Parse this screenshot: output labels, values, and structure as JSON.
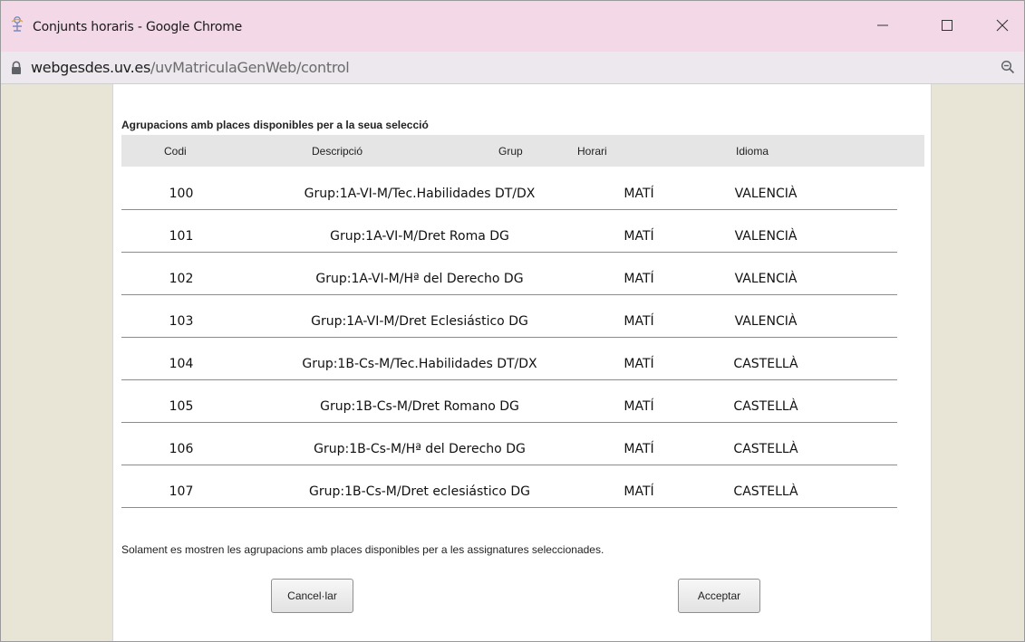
{
  "window": {
    "title": "Conjunts horaris - Google Chrome"
  },
  "address_bar": {
    "host": "webgesdes.uv.es",
    "path": "/uvMatriculaGenWeb/control"
  },
  "dialog": {
    "heading": "Agrupacions amb places disponibles per a la seua selecció",
    "columns": {
      "codi": "Codi",
      "descripcio": "Descripció",
      "grup": "Grup",
      "horari": "Horari",
      "idioma": "Idioma"
    },
    "rows": [
      {
        "codi": "100",
        "descripcio": "Grup:1A-VI-M/Tec.Habilidades DT/DX",
        "horari": "MATÍ",
        "idioma": "VALENCIÀ"
      },
      {
        "codi": "101",
        "descripcio": "Grup:1A-VI-M/Dret Roma DG",
        "horari": "MATÍ",
        "idioma": "VALENCIÀ"
      },
      {
        "codi": "102",
        "descripcio": "Grup:1A-VI-M/Hª del Derecho DG",
        "horari": "MATÍ",
        "idioma": "VALENCIÀ"
      },
      {
        "codi": "103",
        "descripcio": "Grup:1A-VI-M/Dret Eclesiástico DG",
        "horari": "MATÍ",
        "idioma": "VALENCIÀ"
      },
      {
        "codi": "104",
        "descripcio": "Grup:1B-Cs-M/Tec.Habilidades DT/DX",
        "horari": "MATÍ",
        "idioma": "CASTELLÀ"
      },
      {
        "codi": "105",
        "descripcio": "Grup:1B-Cs-M/Dret Romano DG",
        "horari": "MATÍ",
        "idioma": "CASTELLÀ"
      },
      {
        "codi": "106",
        "descripcio": "Grup:1B-Cs-M/Hª del Derecho DG",
        "horari": "MATÍ",
        "idioma": "CASTELLÀ"
      },
      {
        "codi": "107",
        "descripcio": "Grup:1B-Cs-M/Dret eclesiástico DG",
        "horari": "MATÍ",
        "idioma": "CASTELLÀ"
      }
    ],
    "footer_note": "Solament es mostren les agrupacions amb places disponibles per a les assignatures seleccionades.",
    "buttons": {
      "cancel": "Cancel·lar",
      "accept": "Acceptar"
    }
  },
  "icons": {
    "app": "chrome-app-icon",
    "lock": "lock-icon",
    "zoom": "zoom-out-icon",
    "minimize": "minimize-icon",
    "maximize": "maximize-icon",
    "close": "close-icon"
  },
  "colors": {
    "titlebar": "#f3d9e7",
    "page_background": "#e8e5d6",
    "header_row": "#e5e5e5"
  }
}
